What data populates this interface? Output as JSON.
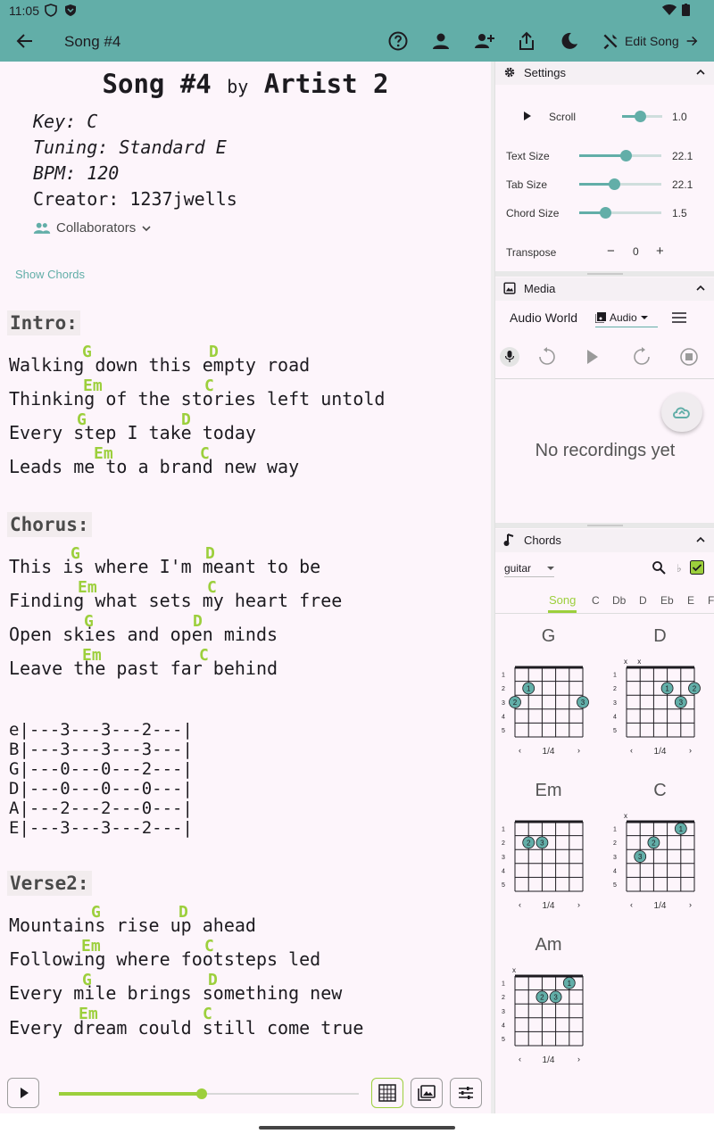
{
  "status": {
    "time": "11:05"
  },
  "appbar": {
    "title": "Song #4",
    "edit_label": "Edit Song"
  },
  "song": {
    "title": "Song #4",
    "by": "by",
    "artist": "Artist 2",
    "key": "Key: C",
    "tuning": "Tuning: Standard E",
    "bpm": "BPM: 120",
    "creator": "Creator: 1237jwells",
    "collaborators_label": "Collaborators",
    "show_chords_label": "Show Chords",
    "sections": [
      {
        "title": "Intro:",
        "lines": [
          "Walking down this empty road",
          "Thinking of the stories left untold",
          "Every step I take today",
          "Leads me to a brand new way"
        ]
      },
      {
        "title": "Chorus:",
        "lines": [
          "This is where I'm meant to be",
          "Finding what sets my heart free",
          "Open skies and open minds",
          "Leave the past far behind"
        ]
      },
      {
        "title": "Verse2:",
        "lines": [
          "Mountains rise up ahead",
          "Following where footsteps led",
          "Every mile brings something new",
          "Every dream could still come true"
        ]
      }
    ],
    "chords": [
      "G",
      "D",
      "Em",
      "C"
    ],
    "tab": [
      "e|---3---3---2---|",
      "B|---3---3---3---|",
      "G|---0---0---2---|",
      "D|---0---0---0---|",
      "A|---2---2---0---|",
      "E|---3---3---2---|"
    ]
  },
  "player": {
    "progress": 0.475
  },
  "settings": {
    "title": "Settings",
    "scroll_label": "Scroll",
    "scroll_value": "1.0",
    "scroll_level": 0.45,
    "text_size_label": "Text Size",
    "text_size_value": "22.1",
    "text_size_level": 0.56,
    "tab_size_label": "Tab Size",
    "tab_size_value": "22.1",
    "tab_size_level": 0.42,
    "chord_size_label": "Chord Size",
    "chord_size_value": "1.5",
    "chord_size_level": 0.32,
    "transpose_label": "Transpose",
    "transpose_minus": "−",
    "transpose_value": "0",
    "transpose_plus": "+"
  },
  "media": {
    "title": "Media",
    "source": "Audio World",
    "type": "Audio",
    "empty_text": "No recordings yet"
  },
  "chords_panel": {
    "title": "Chords",
    "instrument": "guitar",
    "flat_symbol": "♭",
    "tabs": [
      "Song",
      "C",
      "Db",
      "D",
      "Eb",
      "E",
      "F"
    ],
    "cards": [
      {
        "name": "G",
        "pager": "1/4"
      },
      {
        "name": "D",
        "pager": "1/4"
      },
      {
        "name": "Em",
        "pager": "1/4"
      },
      {
        "name": "C",
        "pager": "1/4"
      },
      {
        "name": "Am",
        "pager": "1/4"
      }
    ],
    "fret_numbers": [
      "1",
      "2",
      "3",
      "4",
      "5"
    ],
    "mute_mark": "x",
    "nav_prev": "‹",
    "nav_next": "›"
  },
  "colors": {
    "accent": "#62aea8",
    "chord": "#9ccf3c",
    "background": "#fdf5fb"
  }
}
